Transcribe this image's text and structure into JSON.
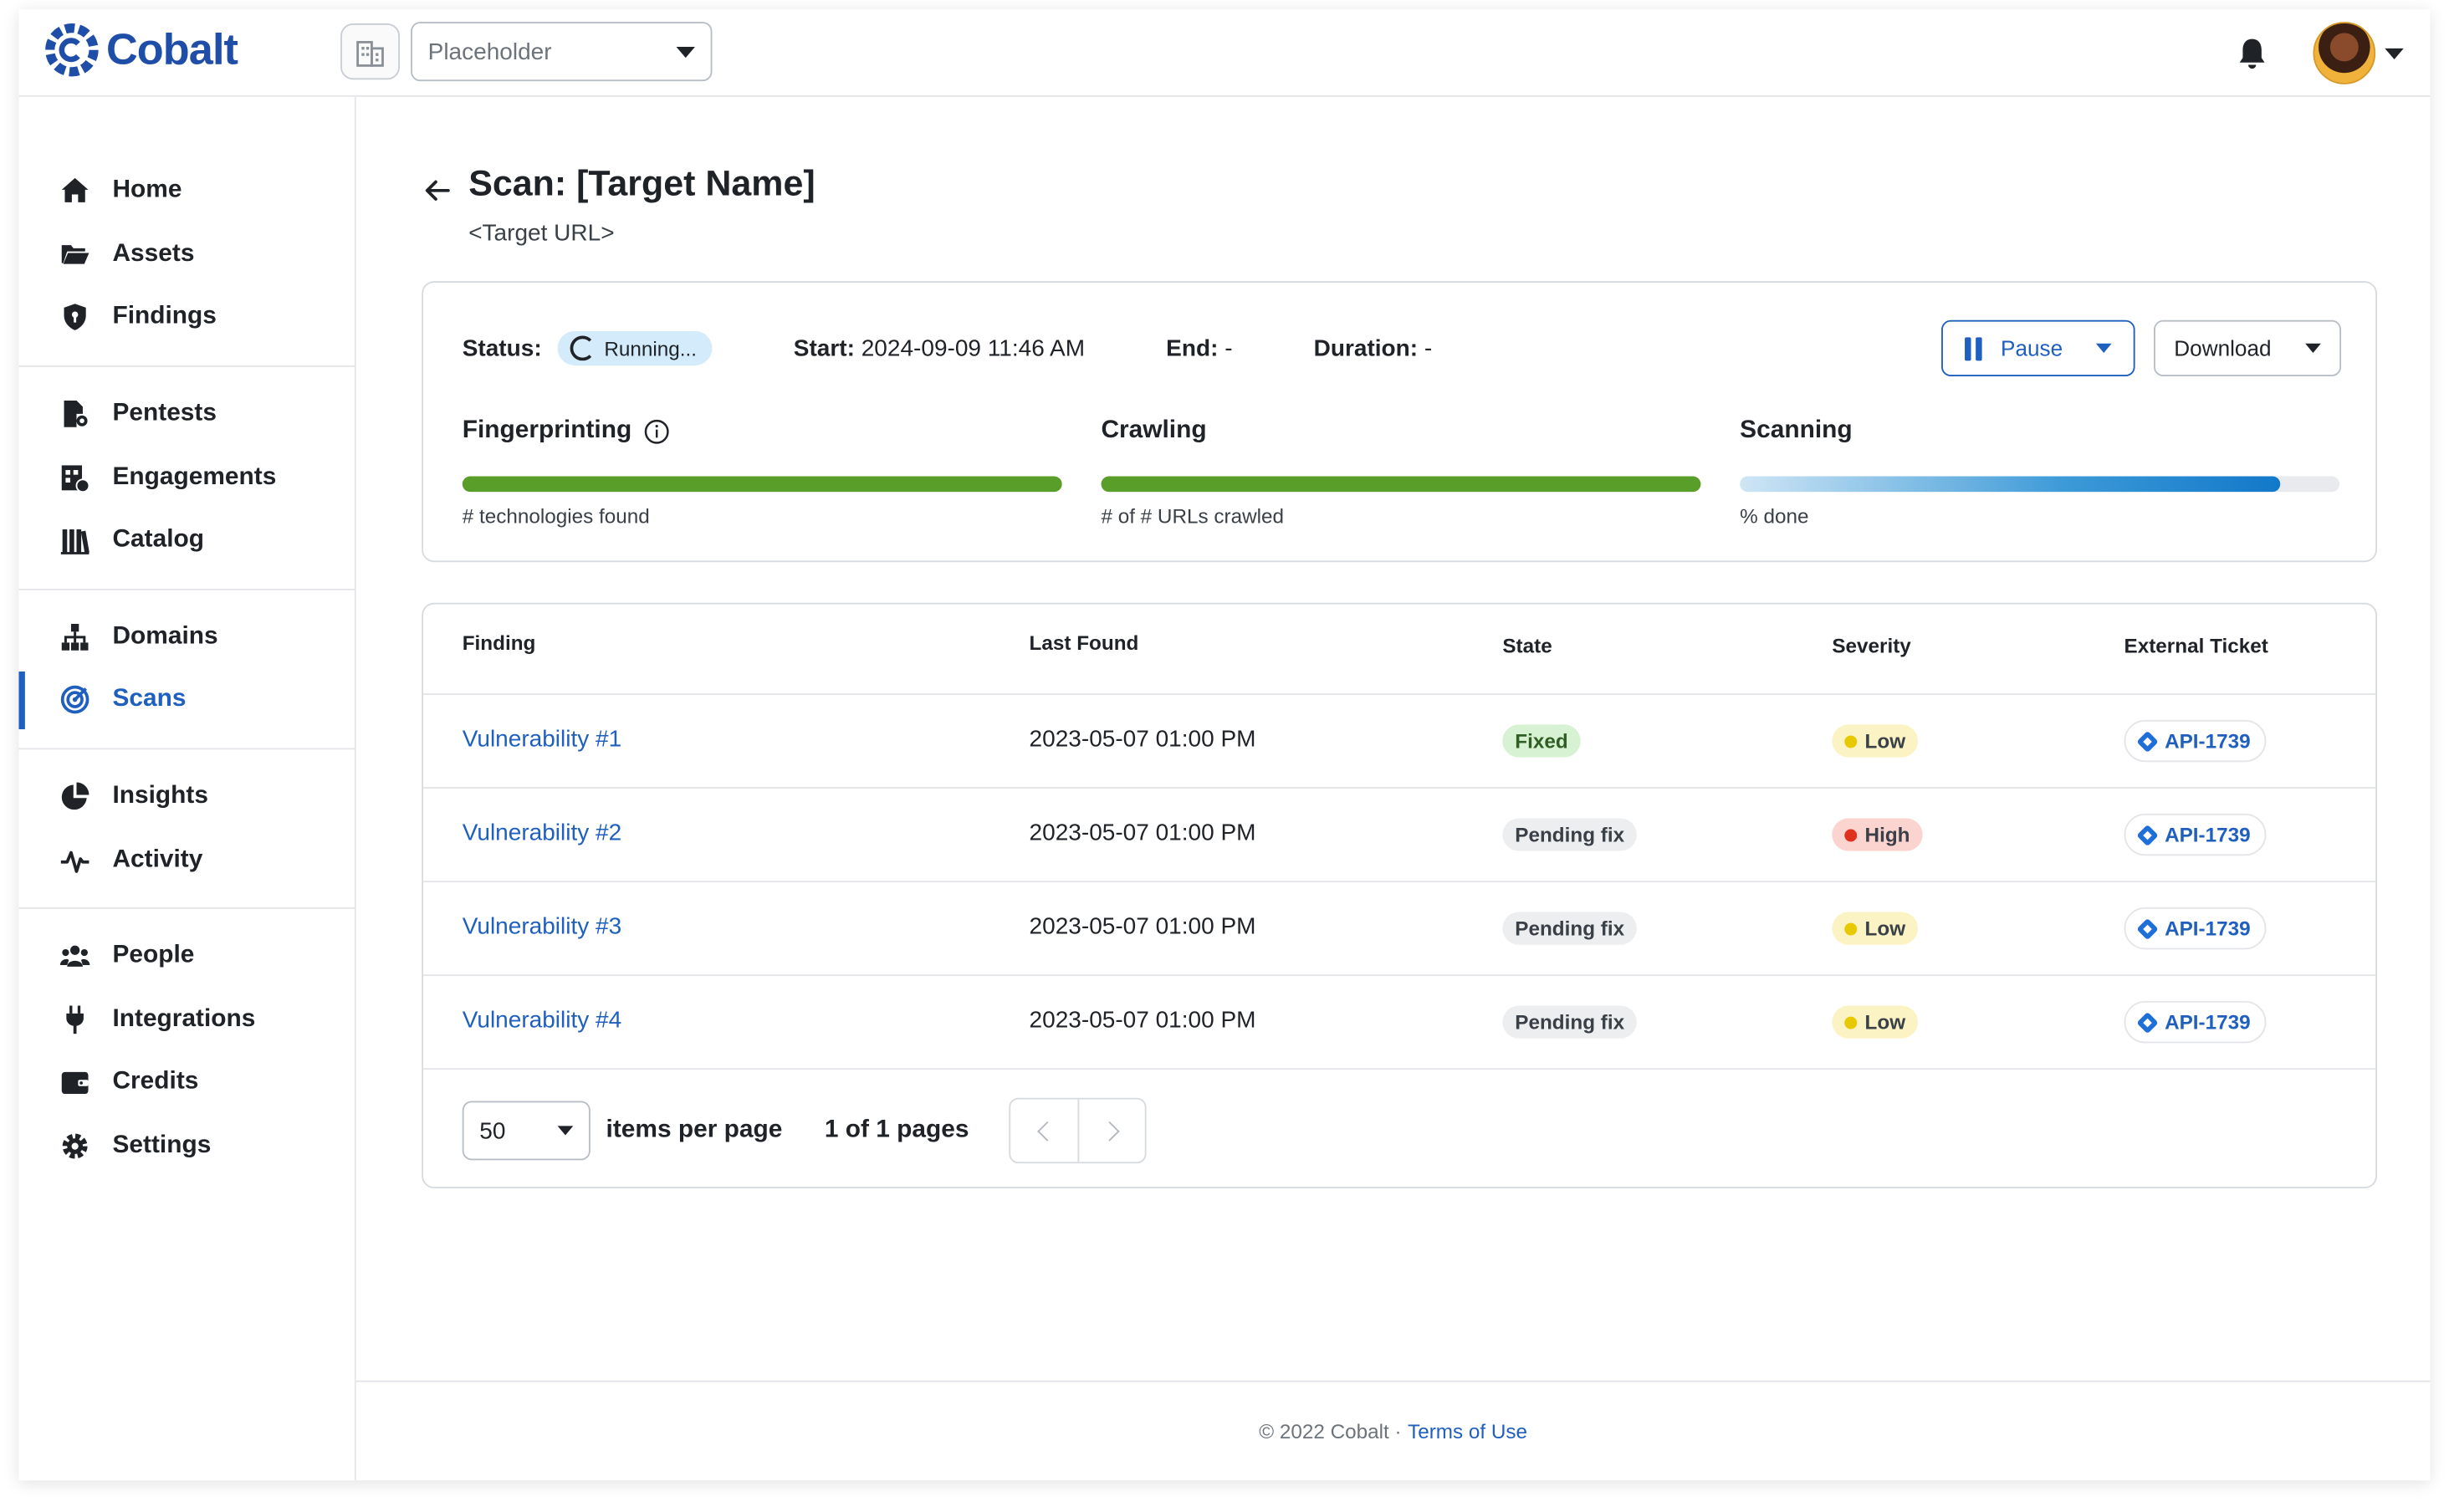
{
  "app": {
    "brand": "Cobalt",
    "brand_color": "#1f4ea8",
    "accent_color": "#1f5fbf"
  },
  "topbar": {
    "org_icon": "building-icon",
    "org_select": {
      "value": "Placeholder"
    },
    "notifications_icon": "bell-icon",
    "avatar_icon": "user-avatar"
  },
  "sidebar": {
    "groups": [
      [
        {
          "label": "Home",
          "icon": "home-icon"
        },
        {
          "label": "Assets",
          "icon": "folder-icon"
        },
        {
          "label": "Findings",
          "icon": "shield-icon"
        }
      ],
      [
        {
          "label": "Pentests",
          "icon": "pentest-icon"
        },
        {
          "label": "Engagements",
          "icon": "engagements-icon"
        },
        {
          "label": "Catalog",
          "icon": "catalog-icon"
        }
      ],
      [
        {
          "label": "Domains",
          "icon": "sitemap-icon"
        },
        {
          "label": "Scans",
          "icon": "target-icon",
          "active": true
        }
      ],
      [
        {
          "label": "Insights",
          "icon": "pie-chart-icon"
        },
        {
          "label": "Activity",
          "icon": "pulse-icon"
        }
      ],
      [
        {
          "label": "People",
          "icon": "people-icon"
        },
        {
          "label": "Integrations",
          "icon": "plug-icon"
        },
        {
          "label": "Credits",
          "icon": "wallet-icon"
        },
        {
          "label": "Settings",
          "icon": "gear-icon"
        }
      ]
    ]
  },
  "page": {
    "title": "Scan: [Target Name]",
    "subtitle": "<Target URL>"
  },
  "status": {
    "status_label": "Status:",
    "status_value": "Running...",
    "start_label": "Start:",
    "start_value": "2024-09-09 11:46 AM",
    "end_label": "End:",
    "end_value": "-",
    "duration_label": "Duration:",
    "duration_value": "-",
    "pause_label": "Pause",
    "download_label": "Download",
    "phases": [
      {
        "title": "Fingerprinting",
        "note": "# technologies found",
        "progress": 1.0,
        "style": "green",
        "has_info": true
      },
      {
        "title": "Crawling",
        "note": "# of # URLs crawled",
        "progress": 1.0,
        "style": "green",
        "has_info": false
      },
      {
        "title": "Scanning",
        "note": "% done",
        "progress": 0.9,
        "style": "blue",
        "has_info": false
      }
    ]
  },
  "table": {
    "headers": [
      "Finding",
      "Last Found",
      "State",
      "Severity",
      "External Ticket"
    ],
    "rows": [
      {
        "finding": "Vulnerability #1",
        "last_found": "2023-05-07 01:00 PM",
        "state": "Fixed",
        "severity": "Low",
        "ticket": "API-1739"
      },
      {
        "finding": "Vulnerability #2",
        "last_found": "2023-05-07 01:00 PM",
        "state": "Pending fix",
        "severity": "High",
        "ticket": "API-1739"
      },
      {
        "finding": "Vulnerability #3",
        "last_found": "2023-05-07 01:00 PM",
        "state": "Pending fix",
        "severity": "Low",
        "ticket": "API-1739"
      },
      {
        "finding": "Vulnerability #4",
        "last_found": "2023-05-07 01:00 PM",
        "state": "Pending fix",
        "severity": "Low",
        "ticket": "API-1739"
      }
    ],
    "severity_colors": {
      "Low": "#e8c800",
      "High": "#e0301e"
    },
    "pagination": {
      "per_page": "50",
      "per_page_label": "items per page",
      "page_count": "1 of 1 pages"
    }
  },
  "footer": {
    "copyright": "© 2022 Cobalt ·",
    "terms_link": "Terms of Use"
  }
}
